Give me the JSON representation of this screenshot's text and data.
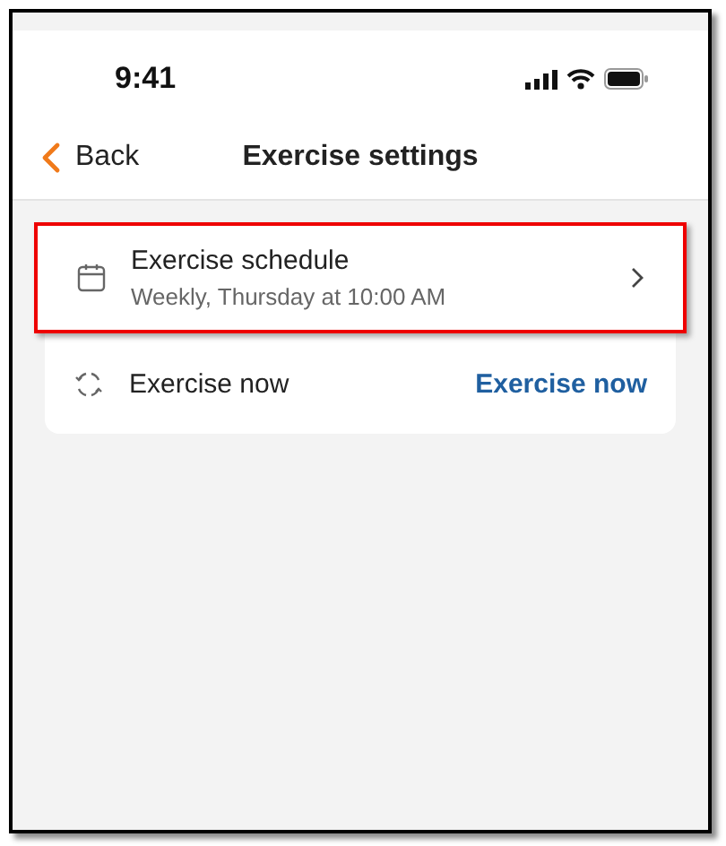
{
  "status_bar": {
    "time": "9:41"
  },
  "nav": {
    "back": "Back",
    "title": "Exercise settings"
  },
  "rows": [
    {
      "kind": "link",
      "title": "Exercise schedule",
      "subtitle": "Weekly, Thursday at 10:00 AM",
      "highlighted": true
    },
    {
      "kind": "action",
      "title": "Exercise now",
      "action": "Exercise now",
      "highlighted": false
    }
  ]
}
